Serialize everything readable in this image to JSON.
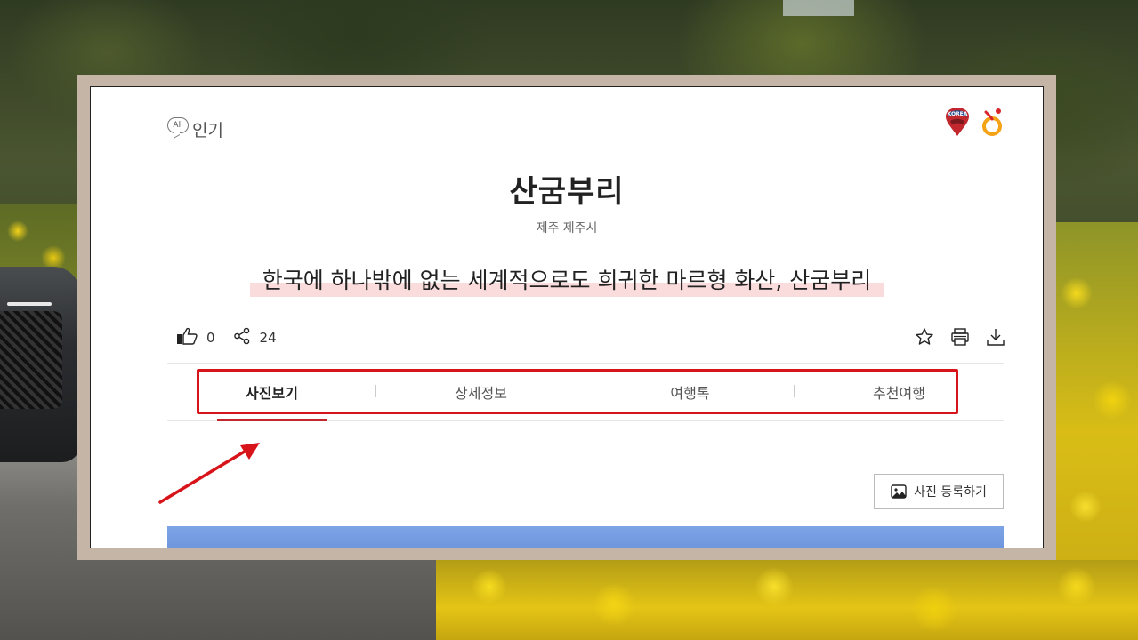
{
  "header": {
    "all_badge": "All",
    "popular_label": "인기"
  },
  "place": {
    "title": "산굼부리",
    "location": "제주 제주시",
    "tagline": "한국에 하나밖에 없는 세계적으로도 희귀한 마르형 화산, 산굼부리"
  },
  "stats": {
    "likes": "0",
    "shares": "24"
  },
  "tabs": [
    {
      "label": "사진보기",
      "active": true
    },
    {
      "label": "상세정보",
      "active": false
    },
    {
      "label": "여행톡",
      "active": false
    },
    {
      "label": "추천여행",
      "active": false
    }
  ],
  "photo_register_label": "사진 등록하기",
  "colors": {
    "accent_red": "#c1272d",
    "highlight_red": "#d8141b",
    "tagline_highlight": "#fbdcdc",
    "frame": "#c4b5a6"
  },
  "icons": [
    "like-icon",
    "share-icon",
    "star-icon",
    "print-icon",
    "download-icon",
    "image-icon",
    "korea-logo-icon",
    "travel-logo-icon"
  ]
}
